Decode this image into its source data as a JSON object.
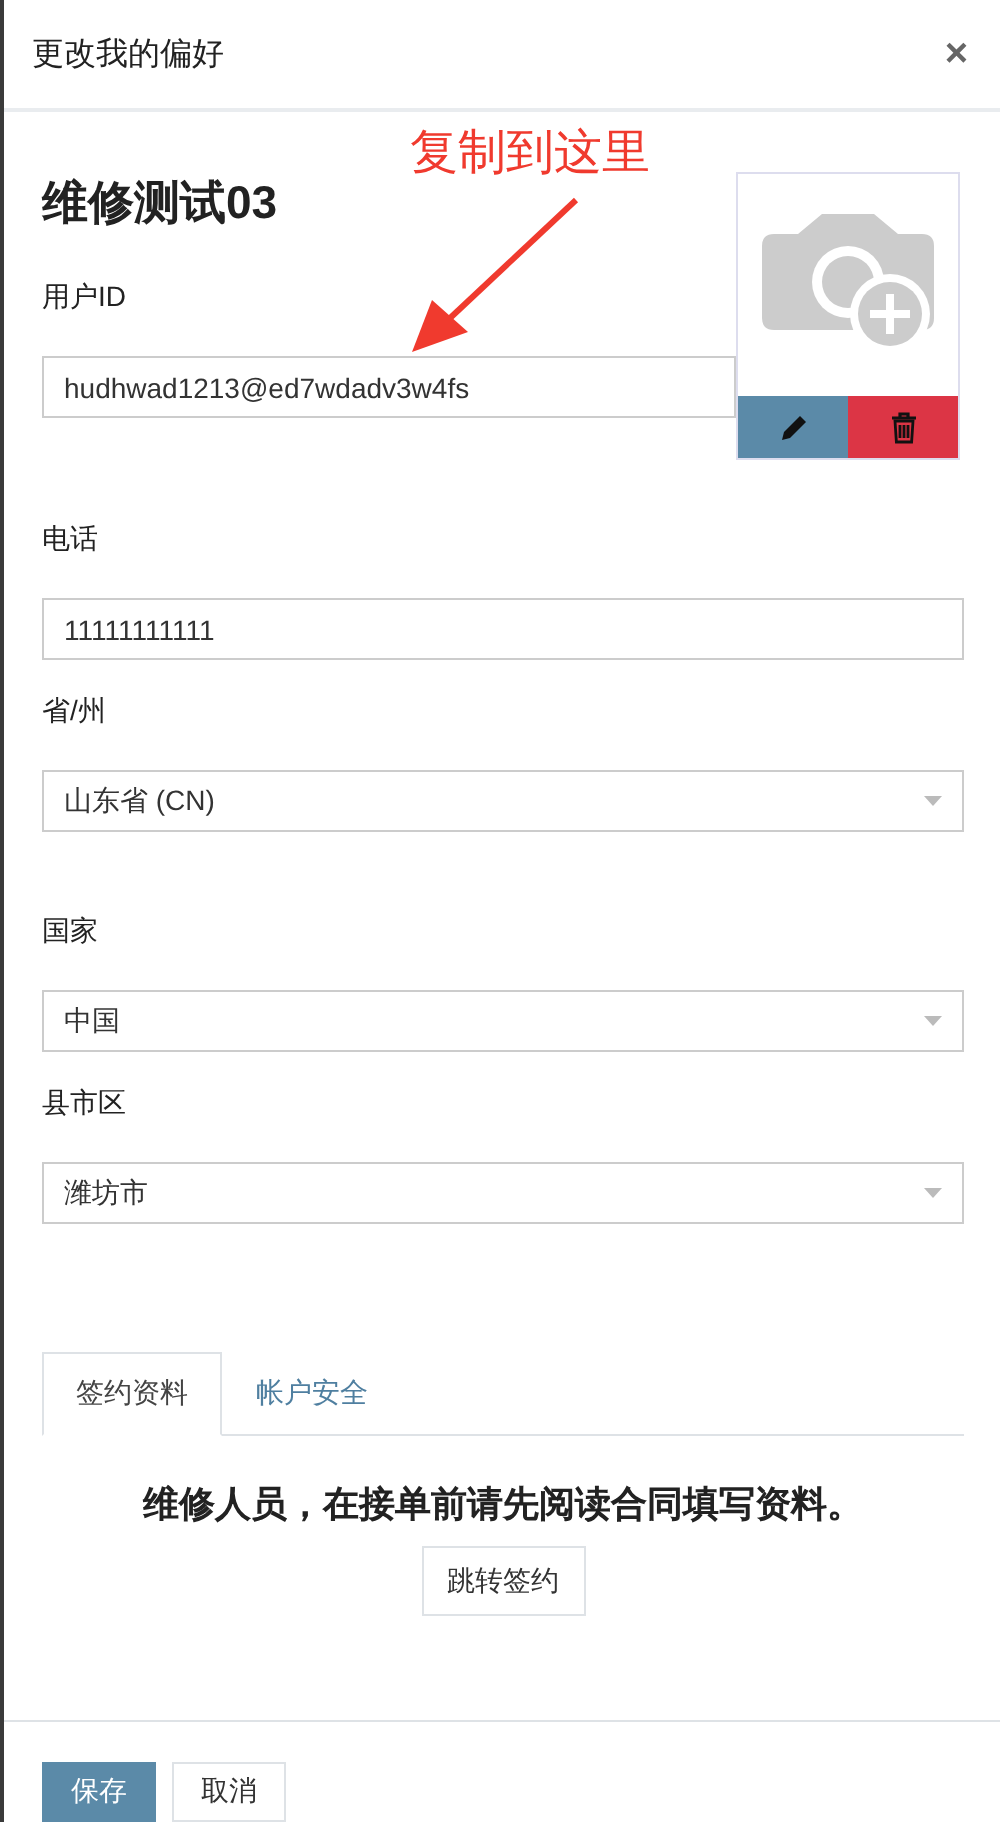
{
  "dialog": {
    "title": "更改我的偏好",
    "close": "×"
  },
  "annotation": {
    "text": "复制到这里"
  },
  "profile": {
    "name": "维修测试03"
  },
  "fields": [
    {
      "kind": "text",
      "label": "用户ID",
      "value": "hudhwad1213@ed7wdadv3w4fs"
    },
    {
      "kind": "text",
      "label": "电话",
      "value": "11111111111"
    },
    {
      "kind": "select",
      "label": "省/州",
      "value": "山东省 (CN)"
    },
    {
      "kind": "select",
      "label": "国家",
      "value": "中国"
    },
    {
      "kind": "select",
      "label": "县市区",
      "value": "潍坊市"
    }
  ],
  "tabs": [
    {
      "label": "签约资料",
      "selected": true
    },
    {
      "label": "帐户安全",
      "selected": false
    }
  ],
  "tab_panel": {
    "message": "维修人员，在接单前请先阅读合同填写资料。",
    "button": "跳转签约"
  },
  "footer_buttons": [
    {
      "label": "保存",
      "kind": "primary"
    },
    {
      "label": "取消",
      "kind": "default"
    }
  ]
}
